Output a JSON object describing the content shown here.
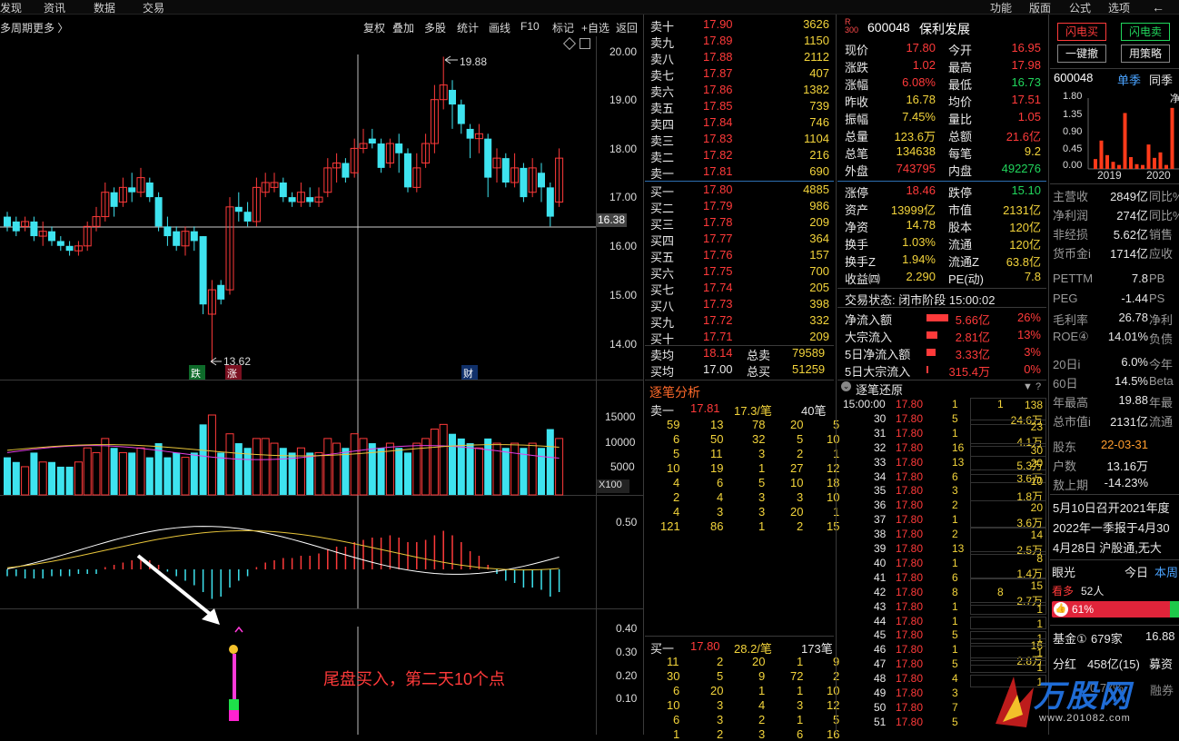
{
  "menu": {
    "items": [
      "发现",
      "资讯",
      "数据",
      "交易"
    ],
    "right": [
      "功能",
      "版面",
      "公式",
      "选项"
    ],
    "back_icon": "arrow-left-icon"
  },
  "toolbar": {
    "left": "多周期",
    "more": "更多 〉",
    "items": [
      "复权",
      "叠加",
      "多股",
      "统计",
      "画线",
      "F10",
      "标记",
      "+自选",
      "返回"
    ]
  },
  "kchart": {
    "yticks": [
      "20.00",
      "19.00",
      "18.00",
      "17.00",
      "16.00",
      "15.00",
      "14.00"
    ],
    "high_label": "19.88",
    "low_label": "13.62",
    "cursor_price": "16.38",
    "markers": [
      "跌",
      "涨",
      "财"
    ]
  },
  "volume": {
    "yticks": [
      "15000",
      "10000",
      "5000"
    ],
    "unit": "X100"
  },
  "macd": {
    "ytick": "0.50"
  },
  "indicator": {
    "yticks": [
      "0.40",
      "0.30",
      "0.20",
      "0.10"
    ],
    "annotation": "尾盘买入，第二天10个点"
  },
  "orderbook": {
    "asks": [
      [
        "卖十",
        "17.90",
        "3626"
      ],
      [
        "卖九",
        "17.89",
        "1150"
      ],
      [
        "卖八",
        "17.88",
        "2112"
      ],
      [
        "卖七",
        "17.87",
        "407"
      ],
      [
        "卖六",
        "17.86",
        "1382"
      ],
      [
        "卖五",
        "17.85",
        "739"
      ],
      [
        "卖四",
        "17.84",
        "746"
      ],
      [
        "卖三",
        "17.83",
        "1104"
      ],
      [
        "卖二",
        "17.82",
        "216"
      ],
      [
        "卖一",
        "17.81",
        "690"
      ]
    ],
    "bids": [
      [
        "买一",
        "17.80",
        "4885"
      ],
      [
        "买二",
        "17.79",
        "986"
      ],
      [
        "买三",
        "17.78",
        "209"
      ],
      [
        "买四",
        "17.77",
        "364"
      ],
      [
        "买五",
        "17.76",
        "157"
      ],
      [
        "买六",
        "17.75",
        "700"
      ],
      [
        "买七",
        "17.74",
        "205"
      ],
      [
        "买八",
        "17.73",
        "398"
      ],
      [
        "买九",
        "17.72",
        "332"
      ],
      [
        "买十",
        "17.71",
        "209"
      ]
    ],
    "avg_sell": [
      "卖均",
      "18.14",
      "总卖",
      "79589"
    ],
    "avg_buy": [
      "买均",
      "17.00",
      "总买",
      "51259"
    ]
  },
  "tick_analysis": {
    "title": "逐笔分析",
    "sell": [
      "卖一",
      "17.81",
      "17.3/笔",
      "40笔"
    ],
    "sell_rows": [
      [
        "59",
        "13",
        "78",
        "20",
        "5"
      ],
      [
        "6",
        "50",
        "32",
        "5",
        "10"
      ],
      [
        "5",
        "11",
        "3",
        "2",
        "1"
      ],
      [
        "10",
        "19",
        "1",
        "27",
        "12"
      ],
      [
        "4",
        "6",
        "5",
        "10",
        "18"
      ],
      [
        "2",
        "4",
        "3",
        "3",
        "10"
      ],
      [
        "4",
        "3",
        "3",
        "20",
        "1"
      ],
      [
        "121",
        "86",
        "1",
        "2",
        "15"
      ]
    ],
    "buy": [
      "买一",
      "17.80",
      "28.2/笔",
      "173笔"
    ],
    "buy_rows": [
      [
        "11",
        "2",
        "20",
        "1",
        "9"
      ],
      [
        "30",
        "5",
        "9",
        "72",
        "2"
      ],
      [
        "6",
        "20",
        "1",
        "1",
        "10"
      ],
      [
        "10",
        "3",
        "4",
        "3",
        "12"
      ],
      [
        "6",
        "3",
        "2",
        "1",
        "5"
      ],
      [
        "1",
        "2",
        "3",
        "6",
        "16"
      ]
    ]
  },
  "stock": {
    "badge_top": "R",
    "badge_bottom": "300",
    "code": "600048",
    "name": "保利发展"
  },
  "quote": [
    [
      "现价",
      "17.80",
      "今开",
      "16.95"
    ],
    [
      "涨跌",
      "1.02",
      "最高",
      "17.98"
    ],
    [
      "涨幅",
      "6.08%",
      "最低",
      "16.73"
    ],
    [
      "昨收",
      "16.78",
      "均价",
      "17.51"
    ],
    [
      "振幅",
      "7.45%",
      "量比",
      "1.05"
    ],
    [
      "总量",
      "123.6万",
      "总额",
      "21.6亿"
    ],
    [
      "总笔",
      "134638",
      "每笔",
      "9.2"
    ],
    [
      "外盘",
      "743795",
      "内盘",
      "492276"
    ],
    [
      "涨停",
      "18.46",
      "跌停",
      "15.10"
    ],
    [
      "资产",
      "13999亿",
      "市值",
      "2131亿"
    ],
    [
      "净资",
      "14.78",
      "股本",
      "120亿"
    ],
    [
      "换手",
      "1.03%",
      "流通",
      "120亿"
    ],
    [
      "换手Z",
      "1.94%",
      "流通Z",
      "63.8亿"
    ],
    [
      "收益㈣",
      "2.290",
      "PE(动)",
      "7.8"
    ]
  ],
  "trade_status": "交易状态: 闭市阶段 15:00:02",
  "flows": [
    [
      "净流入额",
      "5.66亿",
      "26%"
    ],
    [
      "大宗流入",
      "2.81亿",
      "13%"
    ],
    [
      "5日净流入额",
      "3.33亿",
      "3%"
    ],
    [
      "5日大宗流入",
      "315.4万",
      "0%"
    ]
  ],
  "tick_replay": {
    "title": "逐笔还原",
    "first_time": "15:00:00",
    "rows": [
      [
        "",
        "17.80",
        "1",
        "1"
      ],
      [
        "30",
        "17.80",
        "5",
        ""
      ],
      [
        "31",
        "17.80",
        "1",
        ""
      ],
      [
        "32",
        "17.80",
        "16",
        ""
      ],
      [
        "33",
        "17.80",
        "13",
        ""
      ],
      [
        "34",
        "17.80",
        "6",
        ""
      ],
      [
        "35",
        "17.80",
        "3",
        ""
      ],
      [
        "36",
        "17.80",
        "2",
        ""
      ],
      [
        "37",
        "17.80",
        "1",
        ""
      ],
      [
        "38",
        "17.80",
        "2",
        ""
      ],
      [
        "39",
        "17.80",
        "13",
        ""
      ],
      [
        "40",
        "17.80",
        "1",
        ""
      ],
      [
        "41",
        "17.80",
        "6",
        ""
      ],
      [
        "42",
        "17.80",
        "8",
        "8"
      ],
      [
        "43",
        "17.80",
        "1",
        ""
      ],
      [
        "44",
        "17.80",
        "1",
        ""
      ],
      [
        "45",
        "17.80",
        "5",
        ""
      ],
      [
        "46",
        "17.80",
        "1",
        ""
      ],
      [
        "47",
        "17.80",
        "5",
        ""
      ],
      [
        "48",
        "17.80",
        "4",
        ""
      ],
      [
        "49",
        "17.80",
        "3",
        ""
      ],
      [
        "50",
        "17.80",
        "7",
        ""
      ],
      [
        "51",
        "17.80",
        "5",
        ""
      ]
    ],
    "side": [
      [
        "138",
        "24.6万"
      ],
      [
        "23",
        "4.1万"
      ],
      [
        "30",
        "5.3万"
      ],
      [
        "20",
        "3.6万"
      ],
      [
        "10",
        "1.8万"
      ],
      [
        "20",
        "3.6万"
      ],
      [
        "14",
        "2.5万"
      ],
      [
        "8",
        "1.4万"
      ],
      [
        "15",
        "2.7万"
      ],
      [
        "1",
        ""
      ],
      [
        "1",
        ""
      ],
      [
        "1",
        ""
      ],
      [
        "16",
        "2.8万"
      ],
      [
        "1",
        ""
      ],
      [
        "1",
        ""
      ],
      [
        "1",
        ""
      ]
    ]
  },
  "right_panel": {
    "buttons": [
      "闪电买",
      "闪电卖",
      "一键撤",
      "用策略"
    ],
    "code": "600048",
    "tab1": "单季",
    "tab2": "同季",
    "tab3": "净",
    "mini_yticks": [
      "1.80",
      "1.35",
      "0.90",
      "0.45",
      "0.00"
    ],
    "mini_xticks": [
      "2019",
      "2020"
    ],
    "fin": [
      [
        "主营收",
        "2849亿",
        "同比%"
      ],
      [
        "净利润",
        "274亿",
        "同比%"
      ],
      [
        "非经损",
        "5.62亿",
        "销售"
      ],
      [
        "货币金i",
        "1714亿",
        "应收"
      ],
      [
        "PETTM",
        "7.8",
        "PB"
      ],
      [
        "PEG",
        "-1.44",
        "PS"
      ],
      [
        "毛利率",
        "26.78",
        "净利"
      ],
      [
        "ROE④",
        "14.01%",
        "负债"
      ],
      [
        "20日i",
        "6.0%",
        "今年"
      ],
      [
        "60日",
        "14.5%",
        "Beta"
      ],
      [
        "年最高",
        "19.88",
        "年最"
      ],
      [
        "总市值i",
        "2131亿",
        "流通"
      ],
      [
        "股东",
        "22-03-31",
        ""
      ],
      [
        "户数",
        "13.16万",
        ""
      ],
      [
        "敖上期",
        "-14.23%",
        ""
      ]
    ],
    "news": [
      "5月10日召开2021年度",
      "2022年一季报于4月30",
      "4月28日 沪股通,无大"
    ],
    "eye": "眼光",
    "today": "今日",
    "week": "本周",
    "view_label": "看多",
    "view_count": "52人",
    "view_pct": "61%",
    "fund": [
      "基金①",
      "679家",
      "16.88"
    ],
    "dividend": [
      "分红",
      "458亿(15)",
      "募资"
    ],
    "extra": "0.77%",
    "extra2": "融券",
    "watermark": "万股网",
    "watermark_url": "www.201082.com"
  }
}
